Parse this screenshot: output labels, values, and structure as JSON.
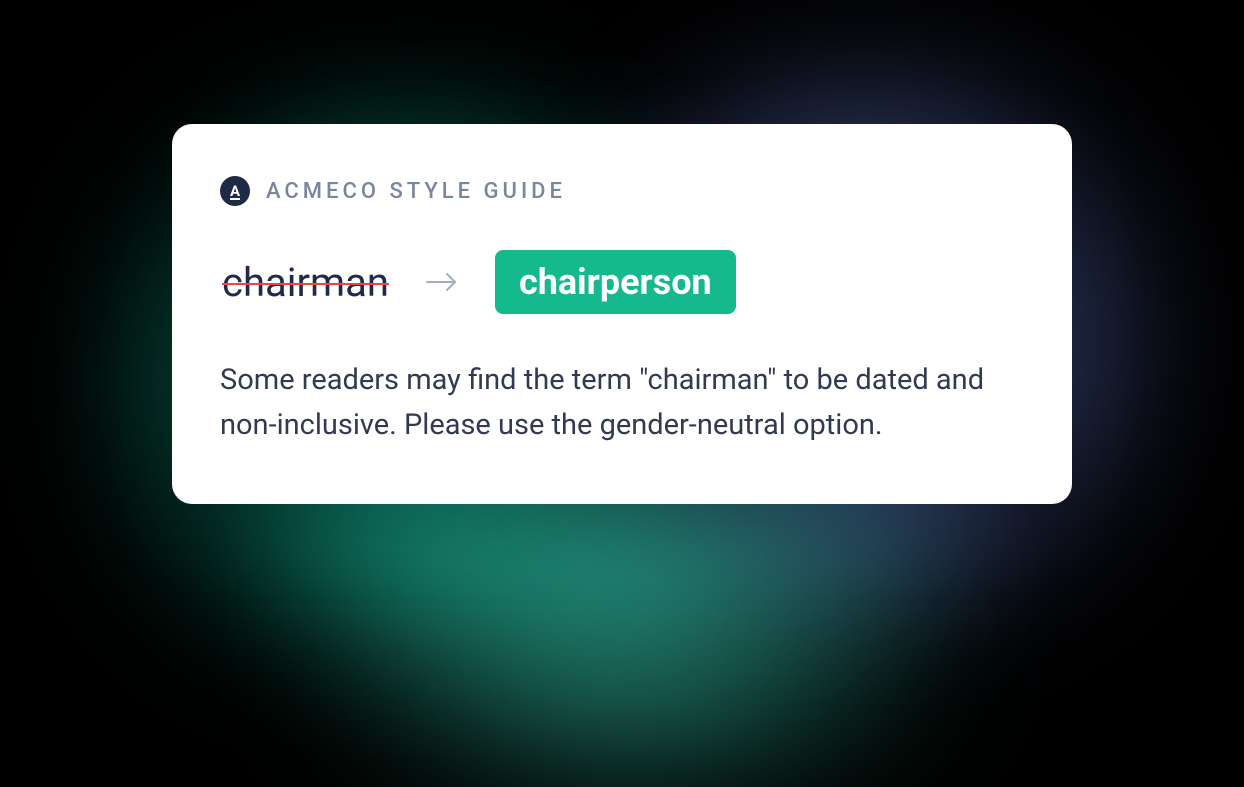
{
  "header": {
    "badge_letter": "A",
    "title": "ACMECO STYLE GUIDE"
  },
  "suggestion": {
    "old_term": "chairman",
    "new_term": "chairperson"
  },
  "explanation": "Some readers may find the term \"chairman\" to be dated and non-inclusive. Please use the gender-neutral option."
}
